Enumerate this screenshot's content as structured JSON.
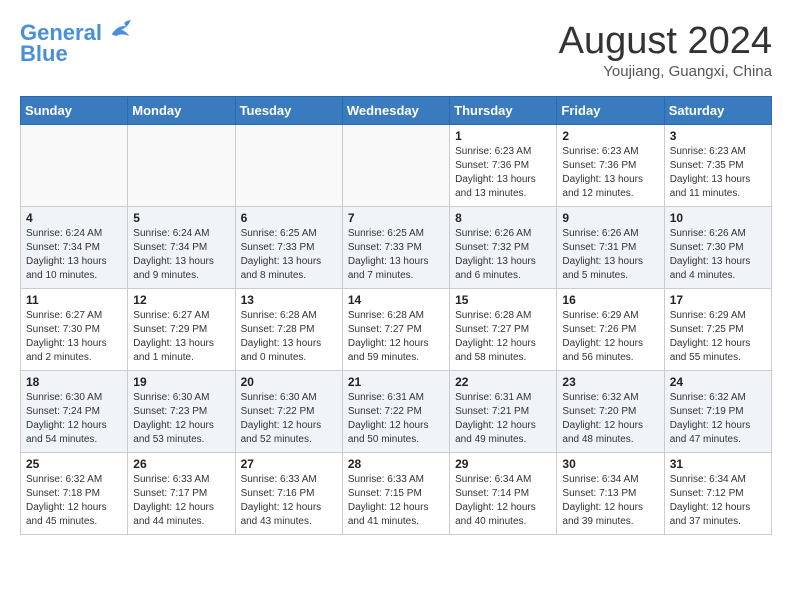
{
  "header": {
    "logo_line1": "General",
    "logo_line2": "Blue",
    "month": "August 2024",
    "location": "Youjiang, Guangxi, China"
  },
  "days_of_week": [
    "Sunday",
    "Monday",
    "Tuesday",
    "Wednesday",
    "Thursday",
    "Friday",
    "Saturday"
  ],
  "weeks": [
    {
      "days": [
        {
          "num": "",
          "info": ""
        },
        {
          "num": "",
          "info": ""
        },
        {
          "num": "",
          "info": ""
        },
        {
          "num": "",
          "info": ""
        },
        {
          "num": "1",
          "info": "Sunrise: 6:23 AM\nSunset: 7:36 PM\nDaylight: 13 hours\nand 13 minutes."
        },
        {
          "num": "2",
          "info": "Sunrise: 6:23 AM\nSunset: 7:36 PM\nDaylight: 13 hours\nand 12 minutes."
        },
        {
          "num": "3",
          "info": "Sunrise: 6:23 AM\nSunset: 7:35 PM\nDaylight: 13 hours\nand 11 minutes."
        }
      ]
    },
    {
      "days": [
        {
          "num": "4",
          "info": "Sunrise: 6:24 AM\nSunset: 7:34 PM\nDaylight: 13 hours\nand 10 minutes."
        },
        {
          "num": "5",
          "info": "Sunrise: 6:24 AM\nSunset: 7:34 PM\nDaylight: 13 hours\nand 9 minutes."
        },
        {
          "num": "6",
          "info": "Sunrise: 6:25 AM\nSunset: 7:33 PM\nDaylight: 13 hours\nand 8 minutes."
        },
        {
          "num": "7",
          "info": "Sunrise: 6:25 AM\nSunset: 7:33 PM\nDaylight: 13 hours\nand 7 minutes."
        },
        {
          "num": "8",
          "info": "Sunrise: 6:26 AM\nSunset: 7:32 PM\nDaylight: 13 hours\nand 6 minutes."
        },
        {
          "num": "9",
          "info": "Sunrise: 6:26 AM\nSunset: 7:31 PM\nDaylight: 13 hours\nand 5 minutes."
        },
        {
          "num": "10",
          "info": "Sunrise: 6:26 AM\nSunset: 7:30 PM\nDaylight: 13 hours\nand 4 minutes."
        }
      ]
    },
    {
      "days": [
        {
          "num": "11",
          "info": "Sunrise: 6:27 AM\nSunset: 7:30 PM\nDaylight: 13 hours\nand 2 minutes."
        },
        {
          "num": "12",
          "info": "Sunrise: 6:27 AM\nSunset: 7:29 PM\nDaylight: 13 hours\nand 1 minute."
        },
        {
          "num": "13",
          "info": "Sunrise: 6:28 AM\nSunset: 7:28 PM\nDaylight: 13 hours\nand 0 minutes."
        },
        {
          "num": "14",
          "info": "Sunrise: 6:28 AM\nSunset: 7:27 PM\nDaylight: 12 hours\nand 59 minutes."
        },
        {
          "num": "15",
          "info": "Sunrise: 6:28 AM\nSunset: 7:27 PM\nDaylight: 12 hours\nand 58 minutes."
        },
        {
          "num": "16",
          "info": "Sunrise: 6:29 AM\nSunset: 7:26 PM\nDaylight: 12 hours\nand 56 minutes."
        },
        {
          "num": "17",
          "info": "Sunrise: 6:29 AM\nSunset: 7:25 PM\nDaylight: 12 hours\nand 55 minutes."
        }
      ]
    },
    {
      "days": [
        {
          "num": "18",
          "info": "Sunrise: 6:30 AM\nSunset: 7:24 PM\nDaylight: 12 hours\nand 54 minutes."
        },
        {
          "num": "19",
          "info": "Sunrise: 6:30 AM\nSunset: 7:23 PM\nDaylight: 12 hours\nand 53 minutes."
        },
        {
          "num": "20",
          "info": "Sunrise: 6:30 AM\nSunset: 7:22 PM\nDaylight: 12 hours\nand 52 minutes."
        },
        {
          "num": "21",
          "info": "Sunrise: 6:31 AM\nSunset: 7:22 PM\nDaylight: 12 hours\nand 50 minutes."
        },
        {
          "num": "22",
          "info": "Sunrise: 6:31 AM\nSunset: 7:21 PM\nDaylight: 12 hours\nand 49 minutes."
        },
        {
          "num": "23",
          "info": "Sunrise: 6:32 AM\nSunset: 7:20 PM\nDaylight: 12 hours\nand 48 minutes."
        },
        {
          "num": "24",
          "info": "Sunrise: 6:32 AM\nSunset: 7:19 PM\nDaylight: 12 hours\nand 47 minutes."
        }
      ]
    },
    {
      "days": [
        {
          "num": "25",
          "info": "Sunrise: 6:32 AM\nSunset: 7:18 PM\nDaylight: 12 hours\nand 45 minutes."
        },
        {
          "num": "26",
          "info": "Sunrise: 6:33 AM\nSunset: 7:17 PM\nDaylight: 12 hours\nand 44 minutes."
        },
        {
          "num": "27",
          "info": "Sunrise: 6:33 AM\nSunset: 7:16 PM\nDaylight: 12 hours\nand 43 minutes."
        },
        {
          "num": "28",
          "info": "Sunrise: 6:33 AM\nSunset: 7:15 PM\nDaylight: 12 hours\nand 41 minutes."
        },
        {
          "num": "29",
          "info": "Sunrise: 6:34 AM\nSunset: 7:14 PM\nDaylight: 12 hours\nand 40 minutes."
        },
        {
          "num": "30",
          "info": "Sunrise: 6:34 AM\nSunset: 7:13 PM\nDaylight: 12 hours\nand 39 minutes."
        },
        {
          "num": "31",
          "info": "Sunrise: 6:34 AM\nSunset: 7:12 PM\nDaylight: 12 hours\nand 37 minutes."
        }
      ]
    }
  ]
}
